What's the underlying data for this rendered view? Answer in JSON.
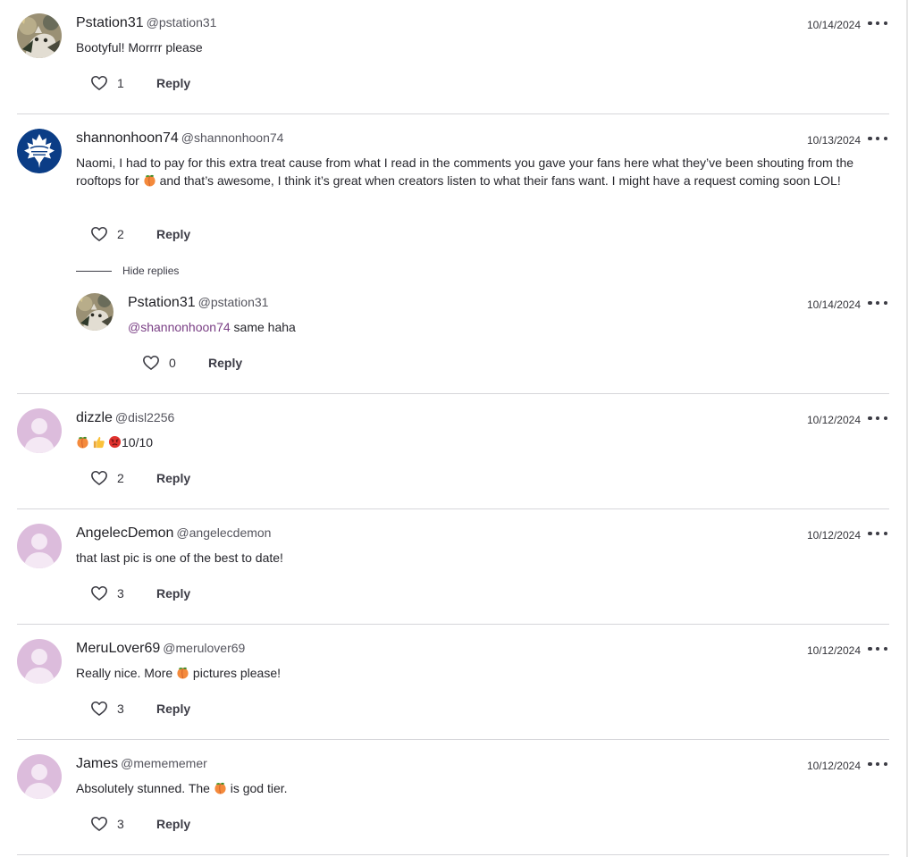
{
  "colors": {
    "accent_mention": "#7a3f85",
    "divider": "#d6d6da",
    "default_avatar": "#dcbcdc"
  },
  "comments": [
    {
      "name": "Pstation31",
      "handle": "@pstation31",
      "date": "10/14/2024",
      "text": "Bootyful! Morrrr please",
      "likes": "1",
      "reply_label": "Reply",
      "avatar": "cat-photo"
    },
    {
      "name": "shannonhoon74",
      "handle": "@shannonhoon74",
      "date": "10/13/2024",
      "text_parts": [
        "Naomi, I had to pay for this extra treat cause from what I read in the comments you gave your fans here what they’ve been shouting from the rooftops for ",
        " and that’s awesome, I think it’s great when creators listen to what their fans want. I might have a request coming soon LOL!"
      ],
      "likes": "2",
      "reply_label": "Reply",
      "avatar": "maple-leafs-logo"
    },
    {
      "name": "dizzle",
      "handle": "@disl2256",
      "date": "10/12/2024",
      "text_suffix": "10/10",
      "emojis": [
        "peach-emoji",
        "thumbs-up-emoji",
        "pouting-face-emoji"
      ],
      "likes": "2",
      "reply_label": "Reply",
      "avatar": "default-user"
    },
    {
      "name": "AngelecDemon",
      "handle": "@angelecdemon",
      "date": "10/12/2024",
      "text": "that last pic is one of the best to date!",
      "likes": "3",
      "reply_label": "Reply",
      "avatar": "default-user"
    },
    {
      "name": "MeruLover69",
      "handle": "@merulover69",
      "date": "10/12/2024",
      "text_parts": [
        "Really nice. More ",
        " pictures please!"
      ],
      "likes": "3",
      "reply_label": "Reply",
      "avatar": "default-user"
    },
    {
      "name": "James",
      "handle": "@memememer",
      "date": "10/12/2024",
      "text_parts": [
        "Absolutely stunned. The ",
        " is god tier."
      ],
      "likes": "3",
      "reply_label": "Reply",
      "avatar": "default-user"
    }
  ],
  "thread": {
    "hide_replies_label": "Hide replies"
  },
  "reply": {
    "name": "Pstation31",
    "handle": "@pstation31",
    "date": "10/14/2024",
    "mention": "@shannonhoon74",
    "text": " same haha",
    "likes": "0",
    "reply_label": "Reply",
    "avatar": "cat-photo"
  }
}
